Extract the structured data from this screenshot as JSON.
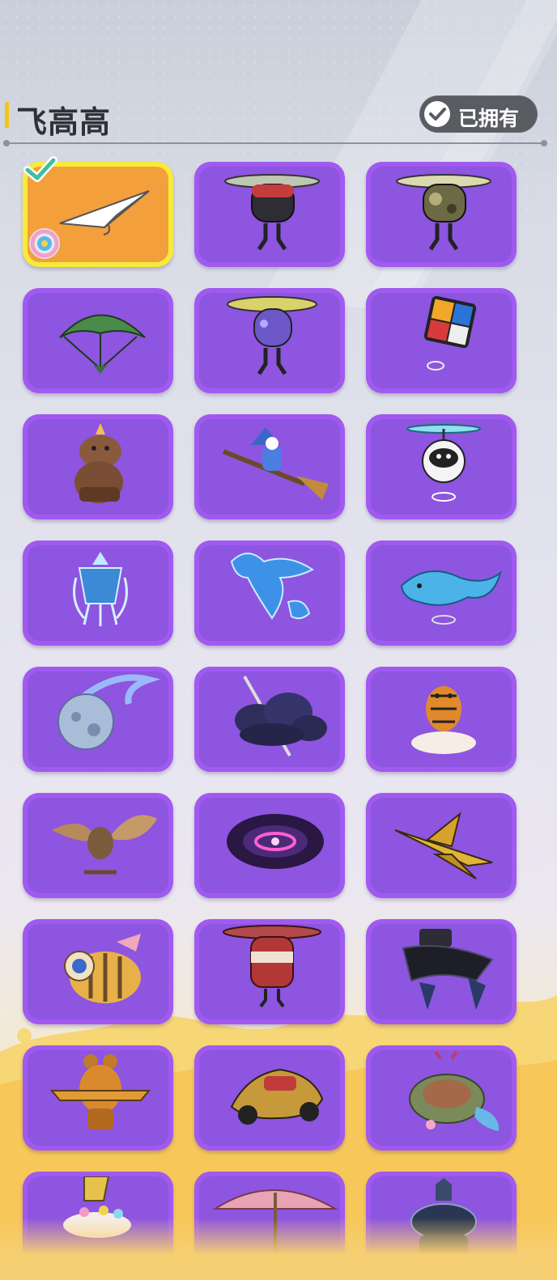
{
  "section": {
    "title": "飞高高",
    "owned_filter_label": "已拥有"
  },
  "colors": {
    "accent": "#f5c21b",
    "card_border": "#a05af0",
    "card_fill": "#8d55e0",
    "selected_fill": "#f39f3c",
    "selected_border": "#f7ea3a"
  },
  "items": [
    {
      "icon": "paper-plane-icon",
      "selected": true,
      "owned": true
    },
    {
      "icon": "propeller-drone-black-icon"
    },
    {
      "icon": "propeller-drone-camo-icon"
    },
    {
      "icon": "green-parachute-icon"
    },
    {
      "icon": "propeller-drone-purple-icon"
    },
    {
      "icon": "rubiks-cube-icon"
    },
    {
      "icon": "capybara-icon"
    },
    {
      "icon": "witch-broom-icon"
    },
    {
      "icon": "helicopter-ball-robot-icon"
    },
    {
      "icon": "ice-lantern-icon"
    },
    {
      "icon": "ice-dragon-icon"
    },
    {
      "icon": "blue-whale-icon"
    },
    {
      "icon": "moon-meteor-icon"
    },
    {
      "icon": "storm-cloud-icon"
    },
    {
      "icon": "tiger-on-cloud-icon"
    },
    {
      "icon": "owl-glider-icon"
    },
    {
      "icon": "galaxy-portal-icon"
    },
    {
      "icon": "golden-jet-icon"
    },
    {
      "icon": "cyclops-bee-icon"
    },
    {
      "icon": "red-can-drone-icon"
    },
    {
      "icon": "dark-mech-wings-icon"
    },
    {
      "icon": "teddy-bear-plane-icon"
    },
    {
      "icon": "golden-car-icon"
    },
    {
      "icon": "turtle-icon"
    },
    {
      "icon": "number-three-cloud-icon"
    },
    {
      "icon": "pink-umbrella-icon"
    },
    {
      "icon": "armored-knight-icon"
    }
  ]
}
